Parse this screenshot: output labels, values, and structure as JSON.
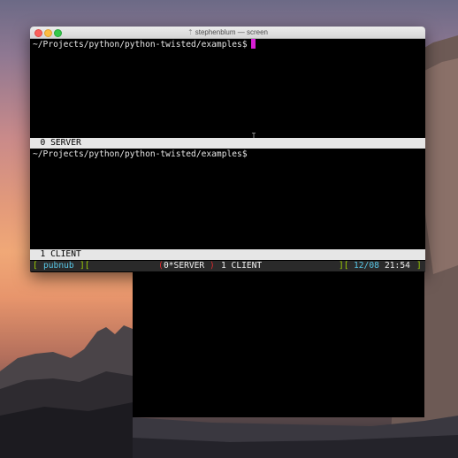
{
  "window": {
    "title": "stephenblum — screen",
    "title_icon": "arrow-up-icon"
  },
  "panes": {
    "top": {
      "prompt": "~/Projects/python/python-twisted/examples$",
      "caption": "  0 SERVER"
    },
    "bottom": {
      "prompt": "~/Projects/python/python-twisted/examples$",
      "caption": "  1 CLIENT"
    }
  },
  "status_bar": {
    "open_bracket": "[",
    "hostname": "pubnub",
    "mid_bracket": "][",
    "windows_left": "(",
    "active_window": "0*SERVER",
    "windows_right": ")",
    "other_window": "1 CLIENT",
    "right_bracket": "][",
    "date": "12/08",
    "time": "21:54",
    "close_bracket": "]"
  },
  "colors": {
    "cursor": "#d91ed6",
    "status_green": "#9fd200",
    "status_cyan": "#57c7e7",
    "status_red": "#e1282d"
  }
}
